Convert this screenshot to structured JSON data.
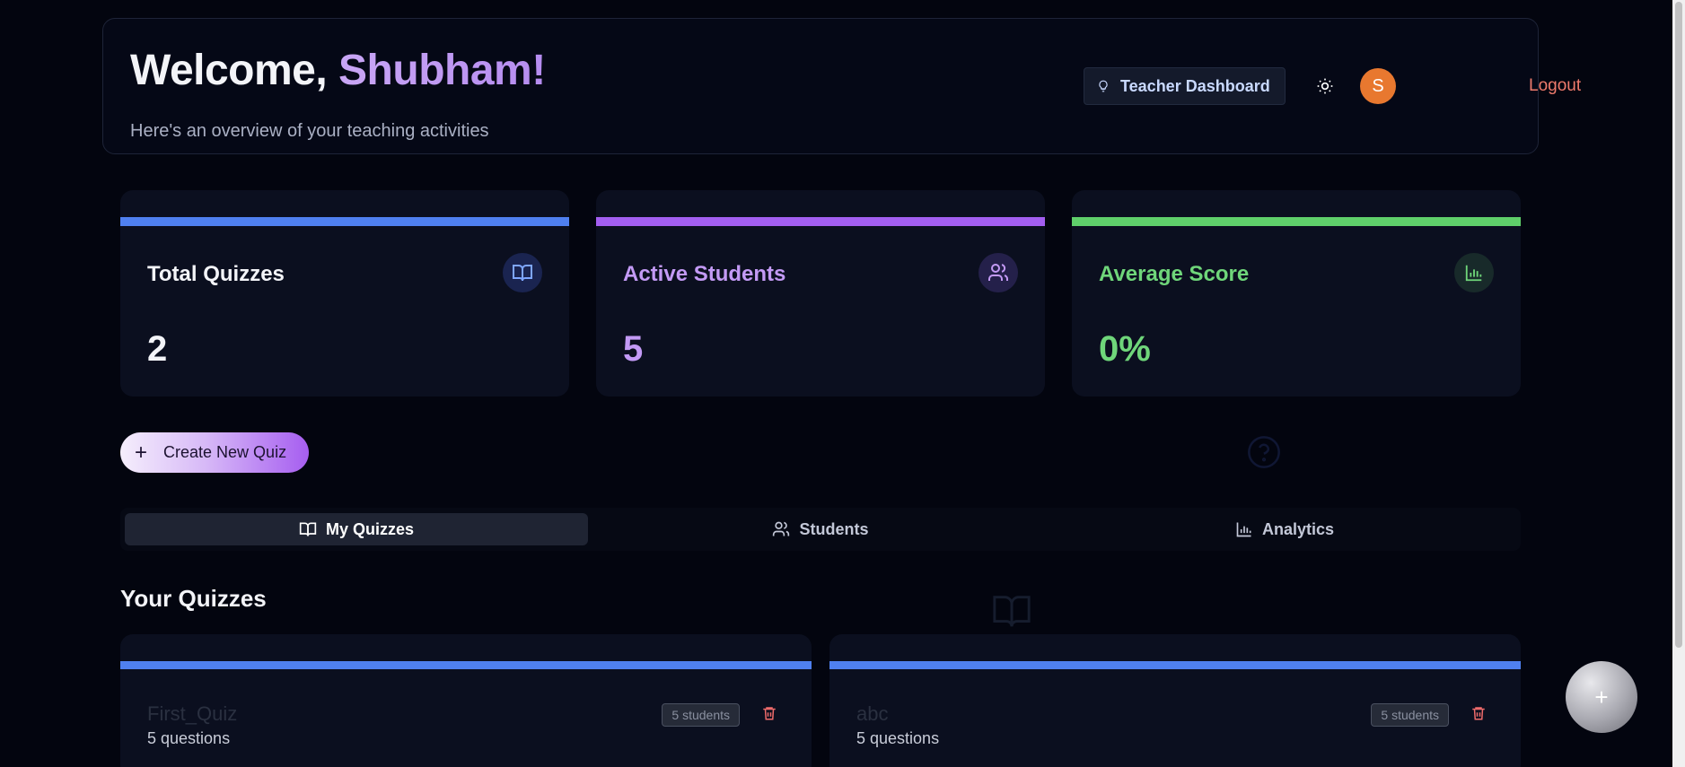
{
  "header": {
    "welcome_prefix": "Welcome, ",
    "welcome_name": "Shubham!",
    "subtitle": "Here's an overview of your teaching activities",
    "role_button": "Teacher Dashboard",
    "avatar_initial": "S",
    "logout_label": "Logout"
  },
  "stats": [
    {
      "label": "Total Quizzes",
      "value": "2",
      "accent": "#4f80f0",
      "icon": "book-open-icon"
    },
    {
      "label": "Active Students",
      "value": "5",
      "accent": "#a35ef0",
      "icon": "users-icon"
    },
    {
      "label": "Average Score",
      "value": "0%",
      "accent": "#5fcf6a",
      "icon": "bar-chart-icon"
    }
  ],
  "create_button": "Create New Quiz",
  "tabs": [
    {
      "label": "My Quizzes",
      "icon": "book-open-icon",
      "active": true
    },
    {
      "label": "Students",
      "icon": "users-icon",
      "active": false
    },
    {
      "label": "Analytics",
      "icon": "bar-chart-icon",
      "active": false
    }
  ],
  "section_title": "Your Quizzes",
  "quizzes": [
    {
      "title": "First_Quiz",
      "questions": "5 questions",
      "students": "5 students"
    },
    {
      "title": "abc",
      "questions": "5 questions",
      "students": "5 students"
    }
  ],
  "fab_label": "+"
}
